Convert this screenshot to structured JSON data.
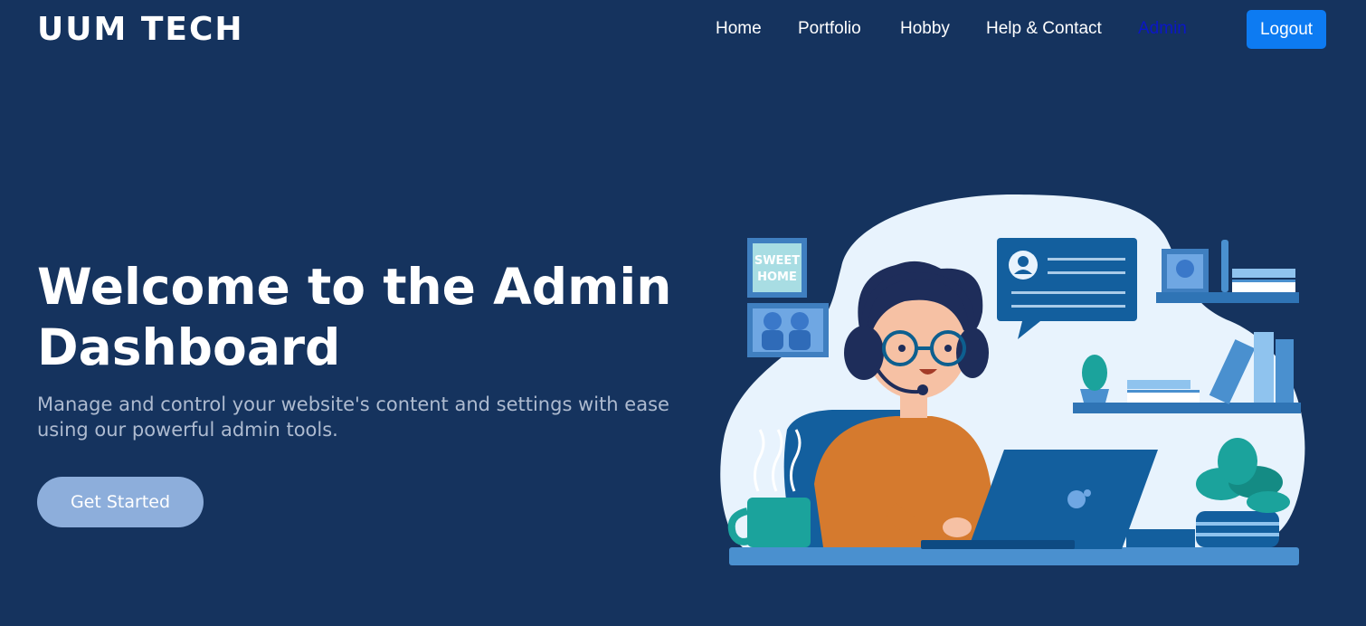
{
  "brand": "UUM TECH",
  "nav": {
    "links": [
      {
        "label": "Home"
      },
      {
        "label": "Portfolio"
      },
      {
        "label": "Hobby"
      },
      {
        "label": "Help & Contact"
      },
      {
        "label": "Admin",
        "active": true
      }
    ],
    "logout_label": "Logout"
  },
  "hero": {
    "title_line1": "Welcome to the Admin",
    "title_line2": "Dashboard",
    "subtitle_line1": "Manage and control your website's content and settings with ease",
    "subtitle_line2": "using our powerful admin tools.",
    "cta_label": "Get Started"
  },
  "illustration": {
    "sign_text_line1": "SWEET",
    "sign_text_line2": "HOME"
  },
  "colors": {
    "background": "#15335e",
    "accent": "#0d7bf2",
    "active_link": "#0b17c6",
    "cta": "#8daedb",
    "subtitle": "#aebbd0"
  }
}
